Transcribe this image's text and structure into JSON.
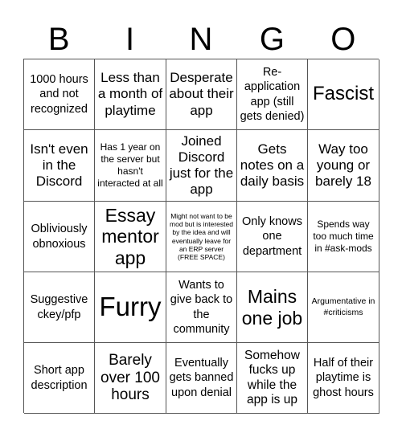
{
  "card": {
    "header": [
      "B",
      "I",
      "N",
      "G",
      "O"
    ],
    "cells": [
      {
        "text": "1000 hours and not recognized",
        "size": "md"
      },
      {
        "text": "Less than a month of playtime",
        "size": "lg"
      },
      {
        "text": "Desperate about their app",
        "size": "lg"
      },
      {
        "text": "Re-application app (still gets denied)",
        "size": "md"
      },
      {
        "text": "Fascist",
        "size": "xxl"
      },
      {
        "text": "Isn't even in the Discord",
        "size": "lg"
      },
      {
        "text": "Has 1 year on the server but hasn't interacted at all",
        "size": "sm"
      },
      {
        "text": "Joined Discord just for the app",
        "size": "lg"
      },
      {
        "text": "Gets notes on a daily basis",
        "size": "lg"
      },
      {
        "text": "Way too young or barely 18",
        "size": "lg"
      },
      {
        "text": "Obliviously obnoxious",
        "size": "md"
      },
      {
        "text": "Essay mentor app",
        "size": "xl"
      },
      {
        "text": "Might not want to be mod but is interested by the idea and will eventually leave for an ERP server (FREE SPACE)",
        "size": "xs"
      },
      {
        "text": "Only knows one department",
        "size": "md"
      },
      {
        "text": "Spends way too much time in #ask-mods",
        "size": "sm"
      },
      {
        "text": "Suggestive ckey/pfp",
        "size": "md"
      },
      {
        "text": "Furry",
        "size": "huge"
      },
      {
        "text": "Wants to give back to the community",
        "size": "md"
      },
      {
        "text": "Mains one job",
        "size": "xl"
      },
      {
        "text": "Argumentative in #criticisms",
        "size": "xs2"
      },
      {
        "text": "Short app description",
        "size": "md"
      },
      {
        "text": "Barely over 100 hours",
        "size": "lg2"
      },
      {
        "text": "Eventually gets banned upon denial",
        "size": "md"
      },
      {
        "text": "Somehow fucks up while the app is up",
        "size": "lg"
      },
      {
        "text": "Half of their playtime is ghost hours",
        "size": "md"
      }
    ]
  }
}
